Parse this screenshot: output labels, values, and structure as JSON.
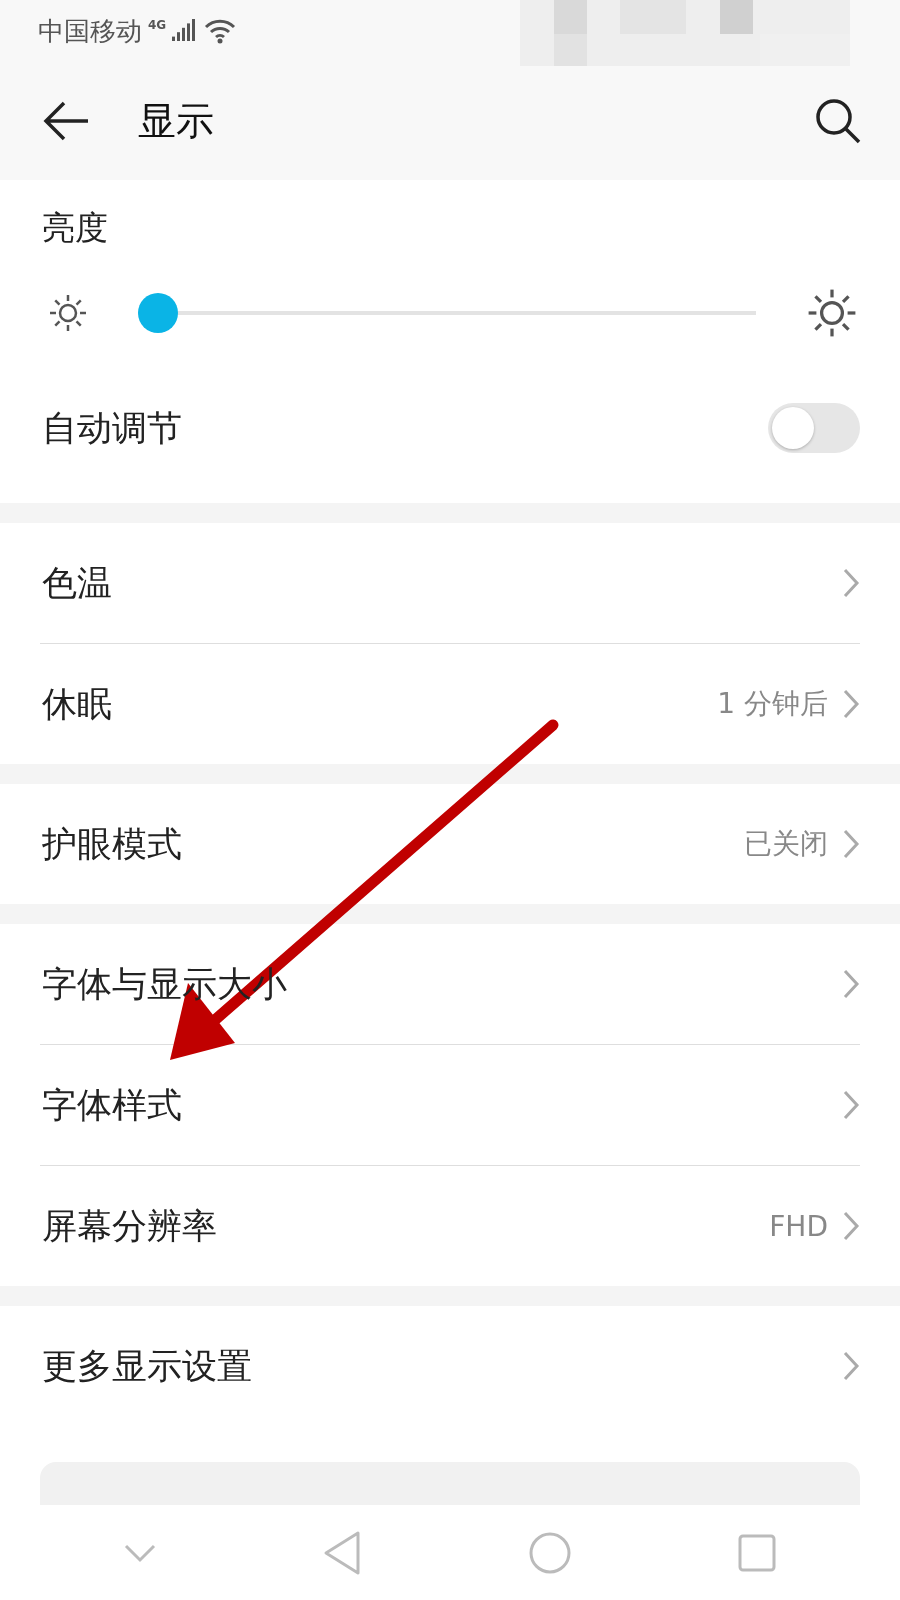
{
  "status_bar": {
    "carrier": "中国移动",
    "network": "4G"
  },
  "header": {
    "title": "显示"
  },
  "brightness": {
    "label": "亮度",
    "level": 0.0
  },
  "auto_adjust": {
    "label": "自动调节",
    "on": false
  },
  "groups": [
    {
      "items": [
        {
          "label": "色温"
        },
        {
          "label": "休眠",
          "value": "1 分钟后"
        }
      ]
    },
    {
      "items": [
        {
          "label": "护眼模式",
          "value": "已关闭"
        }
      ]
    },
    {
      "items": [
        {
          "label": "字体与显示大小"
        },
        {
          "label": "字体样式"
        },
        {
          "label": "屏幕分辨率",
          "value": "FHD"
        }
      ]
    },
    {
      "items": [
        {
          "label": "更多显示设置"
        }
      ]
    }
  ]
}
